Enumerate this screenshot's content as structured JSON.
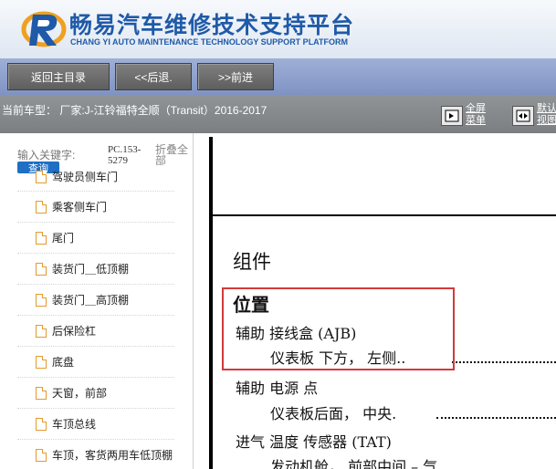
{
  "header": {
    "title": "畅易汽车维修技术支持平台",
    "subtitle": "CHANG YI AUTO MAINTENANCE TECHNOLOGY SUPPORT PLATFORM",
    "brand_color": "#1f5aa8"
  },
  "toolbar": {
    "home_label": "返回主目录",
    "back_label": "<<后退.",
    "forward_label": ">>前进"
  },
  "vehicle_bar": {
    "text": "当前车型： 厂家:J-江铃福特全顺（Transit）2016-2017",
    "fullscreen_label_1": "全屏",
    "fullscreen_label_2": "菜单",
    "default_label_1": "默认",
    "default_label_2": "视图"
  },
  "sidebar": {
    "search_label": "输入关键字:",
    "search_button": "查询",
    "pc_code": "PC.153-5279",
    "collapse_all": "折叠全部",
    "items": [
      {
        "label": "驾驶员侧车门"
      },
      {
        "label": "乘客侧车门"
      },
      {
        "label": "尾门"
      },
      {
        "label": "装货门＿低顶棚"
      },
      {
        "label": "装货门＿高顶棚"
      },
      {
        "label": "后保险杠"
      },
      {
        "label": "底盘"
      },
      {
        "label": "天窗，前部"
      },
      {
        "label": "车顶总线"
      },
      {
        "label": "车顶，客货两用车低顶棚"
      }
    ]
  },
  "content": {
    "heading": "组件",
    "section": "位置",
    "lines": [
      "辅助 接线盒 (AJB)",
      "仪表板 下方， 左侧..",
      "辅助 电源 点",
      "仪表板后面， 中央.",
      "进气 温度 传感器 (TAT)",
      "发动机舱， 前部中间 – 气"
    ],
    "highlight_color": "#d23a3a"
  }
}
